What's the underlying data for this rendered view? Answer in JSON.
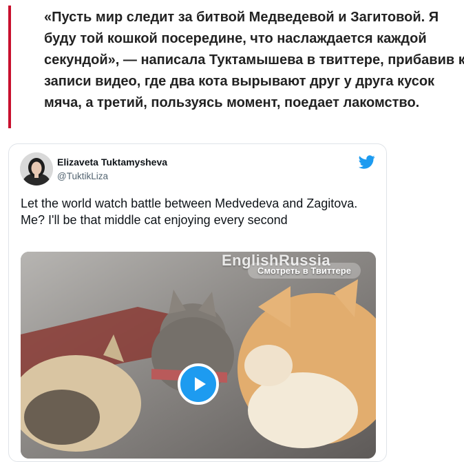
{
  "article": {
    "quote_text": "«Пусть мир следит за битвой Медведевой и Загитовой. Я буду той кошкой посередине, что наслаждается каждой секундой», — написала Туктамышева в твиттере, прибавив к записи видео, где два кота вырывают друг у друга кусок мяча, а третий, пользуясь момент, поедает лакомство.",
    "accent_color": "#c8102e"
  },
  "tweet": {
    "author_name": "Elizaveta Tuktamysheva",
    "author_handle": "@TuktikLiza",
    "text": "Let the world watch battle between Medvedeva and Zagitova. Me? I'll be that middle cat enjoying every second",
    "icon": "twitter-bird-icon",
    "brand_color": "#1d9bf0",
    "media": {
      "watermark": "EnglishRussia",
      "watch_label": "Смотреть в Твиттере",
      "play_icon": "play-icon"
    }
  }
}
